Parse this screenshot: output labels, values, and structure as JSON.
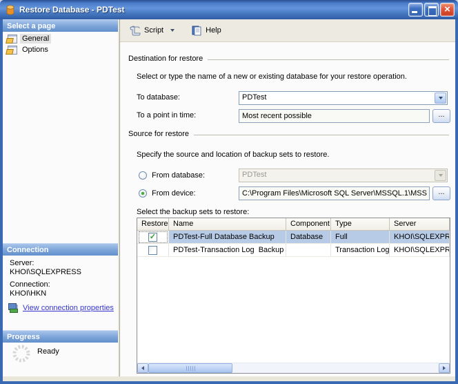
{
  "window": {
    "title": "Restore Database - PDTest"
  },
  "icons": {
    "close": "×",
    "check": "✓"
  },
  "sidebar": {
    "select_page": {
      "header": "Select a page",
      "items": [
        {
          "label": "General"
        },
        {
          "label": "Options"
        }
      ]
    },
    "connection": {
      "header": "Connection",
      "server_label": "Server:",
      "server_value": "KHOI\\SQLEXPRESS",
      "connection_label": "Connection:",
      "connection_value": "KHOI\\HKN",
      "link_label": "View connection properties"
    },
    "progress": {
      "header": "Progress",
      "status": "Ready"
    }
  },
  "toolbar": {
    "script_label": "Script",
    "help_label": "Help"
  },
  "main": {
    "destination": {
      "group_label": "Destination for restore",
      "description": "Select or type the name of a new or existing database for your restore operation.",
      "to_database_label": "To database:",
      "to_database_value": "PDTest",
      "point_in_time_label": "To a point in time:",
      "point_in_time_value": "Most recent possible",
      "browse_label": "..."
    },
    "source": {
      "group_label": "Source for restore",
      "description": "Specify the source and location of backup sets to restore.",
      "from_database_label": "From database:",
      "from_database_value": "PDTest",
      "from_device_label": "From device:",
      "from_device_value": "C:\\Program Files\\Microsoft SQL Server\\MSSQL.1\\MSS",
      "browse_label": "..."
    },
    "backup_sets": {
      "label": "Select the backup sets to restore:",
      "columns": [
        "Restore",
        "Name",
        "Component",
        "Type",
        "Server"
      ],
      "rows": [
        {
          "name": "PDTest-Full Database Backup",
          "component": "Database",
          "type": "Full",
          "server": "KHOI\\SQLEXPRESS"
        },
        {
          "name": "PDTest-Transaction Log  Backup",
          "component": "",
          "type": "Transaction Log",
          "server": "KHOI\\SQLEXPRESS"
        }
      ]
    }
  }
}
